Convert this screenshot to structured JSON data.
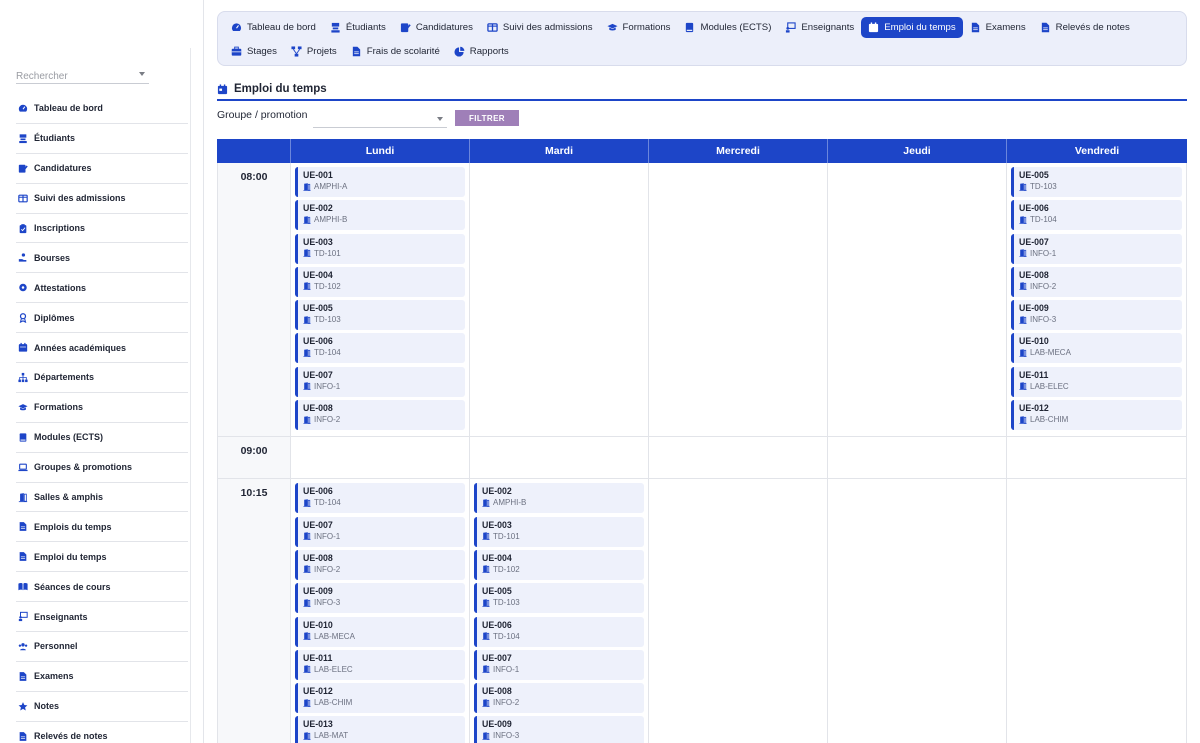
{
  "colors": {
    "accent": "#1d45c8",
    "filter_button": "#9f7fb8",
    "nav_bg": "#eceffa"
  },
  "sidebar": {
    "search_placeholder": "Rechercher",
    "items": [
      {
        "label": "Tableau de bord",
        "icon": "dashboard-icon"
      },
      {
        "label": "Étudiants",
        "icon": "student-icon"
      },
      {
        "label": "Candidatures",
        "icon": "application-icon"
      },
      {
        "label": "Suivi des admissions",
        "icon": "columns-icon"
      },
      {
        "label": "Inscriptions",
        "icon": "clipboard-icon"
      },
      {
        "label": "Bourses",
        "icon": "hand-coin-icon"
      },
      {
        "label": "Attestations",
        "icon": "badge-icon"
      },
      {
        "label": "Diplômes",
        "icon": "diploma-icon"
      },
      {
        "label": "Années académiques",
        "icon": "calendar-icon"
      },
      {
        "label": "Départements",
        "icon": "sitemap-icon"
      },
      {
        "label": "Formations",
        "icon": "graduation-cap-icon"
      },
      {
        "label": "Modules (ECTS)",
        "icon": "book-icon"
      },
      {
        "label": "Groupes & promotions",
        "icon": "laptop-icon"
      },
      {
        "label": "Salles & amphis",
        "icon": "door-icon"
      },
      {
        "label": "Emplois du temps",
        "icon": "document-icon"
      },
      {
        "label": "Emploi du temps",
        "icon": "document-icon"
      },
      {
        "label": "Séances de cours",
        "icon": "open-book-icon"
      },
      {
        "label": "Enseignants",
        "icon": "teacher-icon"
      },
      {
        "label": "Personnel",
        "icon": "users-icon"
      },
      {
        "label": "Examens",
        "icon": "document-icon"
      },
      {
        "label": "Notes",
        "icon": "star-icon"
      },
      {
        "label": "Relevés de notes",
        "icon": "document-icon"
      }
    ]
  },
  "topnav": {
    "row1": [
      {
        "label": "Tableau de bord",
        "icon": "dashboard-icon",
        "active": false
      },
      {
        "label": "Étudiants",
        "icon": "student-icon",
        "active": false
      },
      {
        "label": "Candidatures",
        "icon": "application-icon",
        "active": false
      },
      {
        "label": "Suivi des admissions",
        "icon": "columns-icon",
        "active": false
      },
      {
        "label": "Formations",
        "icon": "graduation-cap-icon",
        "active": false
      },
      {
        "label": "Modules (ECTS)",
        "icon": "book-icon",
        "active": false
      },
      {
        "label": "Enseignants",
        "icon": "teacher-icon",
        "active": false
      },
      {
        "label": "Emploi du temps",
        "icon": "calendar-icon",
        "active": true
      },
      {
        "label": "Examens",
        "icon": "document-icon",
        "active": false
      },
      {
        "label": "Relevés de notes",
        "icon": "document-icon",
        "active": false
      }
    ],
    "row2": [
      {
        "label": "Stages",
        "icon": "briefcase-icon",
        "active": false
      },
      {
        "label": "Projets",
        "icon": "project-icon",
        "active": false
      },
      {
        "label": "Frais de scolarité",
        "icon": "document-icon",
        "active": false
      },
      {
        "label": "Rapports",
        "icon": "pie-chart-icon",
        "active": false
      }
    ]
  },
  "page": {
    "title": "Emploi du temps",
    "filter_label": "Groupe / promotion",
    "filter_value": "",
    "filter_button": "FILTRER"
  },
  "timetable": {
    "days": [
      "Lundi",
      "Mardi",
      "Mercredi",
      "Jeudi",
      "Vendredi"
    ],
    "rows": [
      {
        "time": "08:00",
        "cells": [
          [
            {
              "code": "UE-001",
              "room": "AMPHI-A"
            },
            {
              "code": "UE-002",
              "room": "AMPHI-B"
            },
            {
              "code": "UE-003",
              "room": "TD-101"
            },
            {
              "code": "UE-004",
              "room": "TD-102"
            },
            {
              "code": "UE-005",
              "room": "TD-103"
            },
            {
              "code": "UE-006",
              "room": "TD-104"
            },
            {
              "code": "UE-007",
              "room": "INFO-1"
            },
            {
              "code": "UE-008",
              "room": "INFO-2"
            }
          ],
          [],
          [],
          [],
          [
            {
              "code": "UE-005",
              "room": "TD-103"
            },
            {
              "code": "UE-006",
              "room": "TD-104"
            },
            {
              "code": "UE-007",
              "room": "INFO-1"
            },
            {
              "code": "UE-008",
              "room": "INFO-2"
            },
            {
              "code": "UE-009",
              "room": "INFO-3"
            },
            {
              "code": "UE-010",
              "room": "LAB-MECA"
            },
            {
              "code": "UE-011",
              "room": "LAB-ELEC"
            },
            {
              "code": "UE-012",
              "room": "LAB-CHIM"
            }
          ]
        ]
      },
      {
        "time": "09:00",
        "cells": [
          [],
          [],
          [],
          [],
          []
        ]
      },
      {
        "time": "10:15",
        "cells": [
          [
            {
              "code": "UE-006",
              "room": "TD-104"
            },
            {
              "code": "UE-007",
              "room": "INFO-1"
            },
            {
              "code": "UE-008",
              "room": "INFO-2"
            },
            {
              "code": "UE-009",
              "room": "INFO-3"
            },
            {
              "code": "UE-010",
              "room": "LAB-MECA"
            },
            {
              "code": "UE-011",
              "room": "LAB-ELEC"
            },
            {
              "code": "UE-012",
              "room": "LAB-CHIM"
            },
            {
              "code": "UE-013",
              "room": "LAB-MAT"
            }
          ],
          [
            {
              "code": "UE-002",
              "room": "AMPHI-B"
            },
            {
              "code": "UE-003",
              "room": "TD-101"
            },
            {
              "code": "UE-004",
              "room": "TD-102"
            },
            {
              "code": "UE-005",
              "room": "TD-103"
            },
            {
              "code": "UE-006",
              "room": "TD-104"
            },
            {
              "code": "UE-007",
              "room": "INFO-1"
            },
            {
              "code": "UE-008",
              "room": "INFO-2"
            },
            {
              "code": "UE-009",
              "room": "INFO-3"
            }
          ],
          [],
          [],
          []
        ]
      }
    ]
  }
}
